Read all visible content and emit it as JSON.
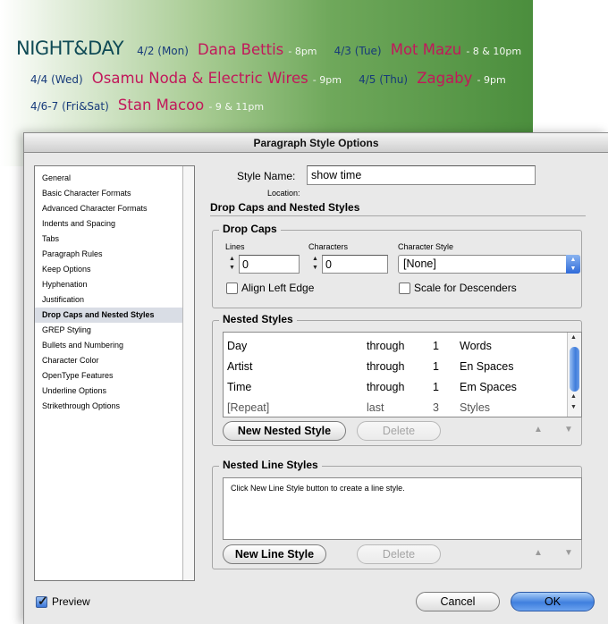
{
  "banner": {
    "logo": "NIGHT&DAY",
    "events": [
      {
        "date": "4/2 (Mon)",
        "artist": "Dana Bettis",
        "time": " - 8pm"
      },
      {
        "date": "4/3 (Tue)",
        "artist": "Mot Mazu",
        "time": " - 8 & 10pm"
      },
      {
        "date": "4/4 (Wed)",
        "artist": "Osamu Noda & Electric Wires",
        "time": " - 9pm"
      },
      {
        "date": "4/5 (Thu)",
        "artist": "Zagaby",
        "time": " - 9pm"
      },
      {
        "date": "4/6-7 (Fri&Sat)",
        "artist": "Stan Macoo",
        "time": " - 9 & 11pm"
      }
    ],
    "colors": {
      "logo": "#0f4a55",
      "artist": "#c2185b",
      "date": "#163a7a"
    }
  },
  "dialog": {
    "title": "Paragraph Style Options",
    "categories": [
      "General",
      "Basic Character Formats",
      "Advanced Character Formats",
      "Indents and Spacing",
      "Tabs",
      "Paragraph Rules",
      "Keep Options",
      "Hyphenation",
      "Justification",
      "Drop Caps and Nested Styles",
      "GREP Styling",
      "Bullets and Numbering",
      "Character Color",
      "OpenType Features",
      "Underline Options",
      "Strikethrough Options"
    ],
    "selected_category": "Drop Caps and Nested Styles",
    "style_name_label": "Style Name:",
    "style_name_value": "show time",
    "location_label": "Location:",
    "section_title": "Drop Caps and Nested Styles",
    "drop_caps": {
      "group_label": "Drop Caps",
      "lines_label": "Lines",
      "lines_value": "0",
      "characters_label": "Characters",
      "characters_value": "0",
      "char_style_label": "Character Style",
      "char_style_value": "[None]",
      "align_left_edge": "Align Left Edge",
      "scale_descenders": "Scale for Descenders"
    },
    "nested_styles": {
      "group_label": "Nested Styles",
      "rows": [
        {
          "style": "Day",
          "mode": "through",
          "count": "1",
          "unit": "Words"
        },
        {
          "style": "Artist",
          "mode": "through",
          "count": "1",
          "unit": "En Spaces"
        },
        {
          "style": "Time",
          "mode": "through",
          "count": "1",
          "unit": "Em Spaces"
        },
        {
          "style": "[Repeat]",
          "mode": "last",
          "count": "3",
          "unit": "Styles"
        }
      ],
      "new_button": "New Nested Style",
      "delete_button": "Delete"
    },
    "nested_line_styles": {
      "group_label": "Nested Line Styles",
      "hint": "Click New Line Style button to create a line style.",
      "new_button": "New Line Style",
      "delete_button": "Delete"
    },
    "preview_label": "Preview",
    "cancel_button": "Cancel",
    "ok_button": "OK"
  }
}
